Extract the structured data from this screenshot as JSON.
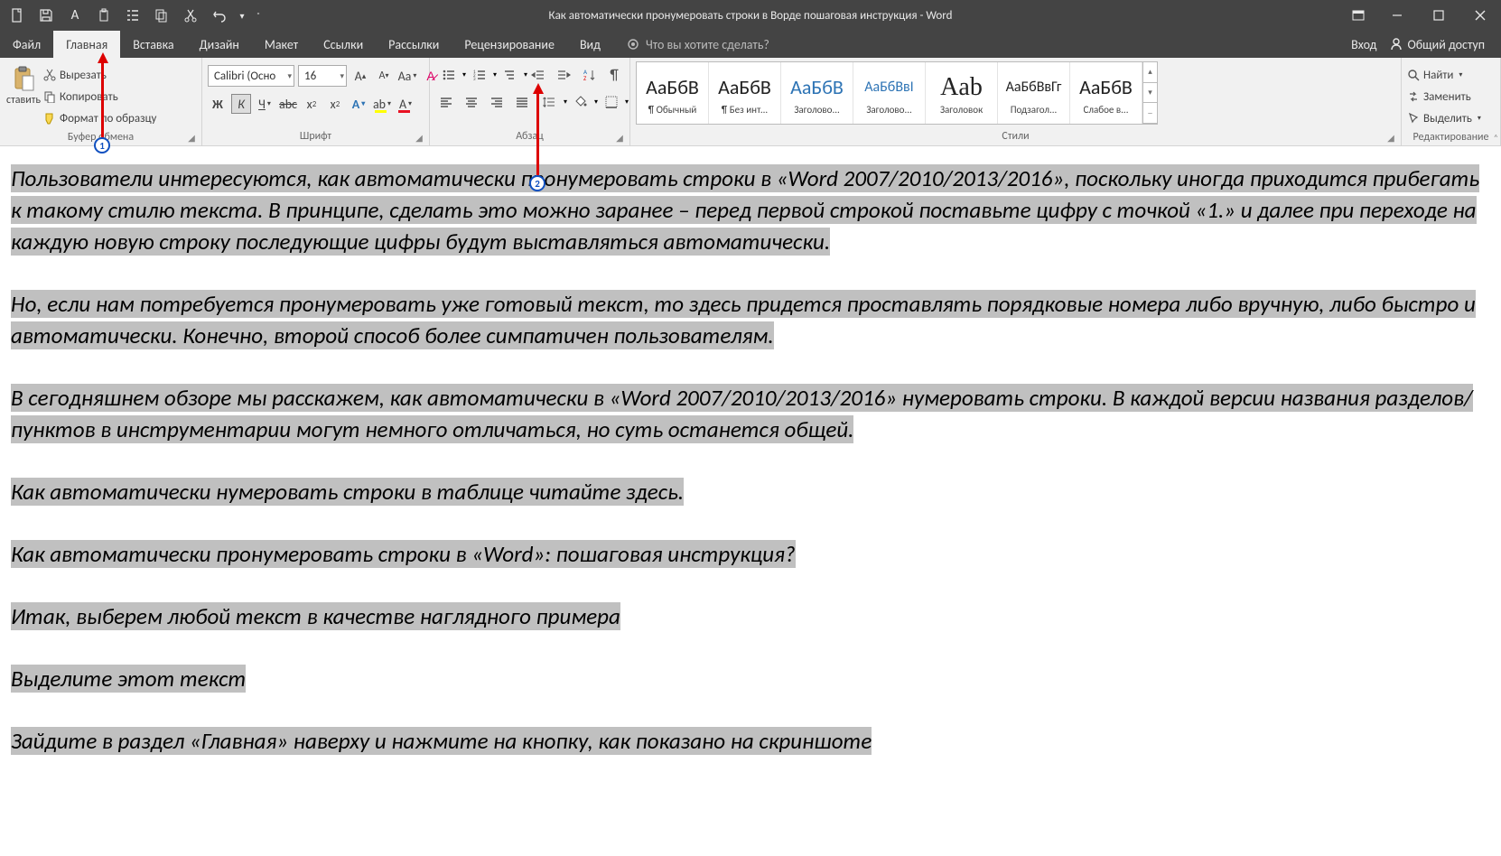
{
  "title": "Как автоматически пронумеровать строки в Ворде пошаговая инструкция - Word",
  "tabs": {
    "file": "Файл",
    "home": "Главная",
    "insert": "Вставка",
    "design": "Дизайн",
    "layout": "Макет",
    "references": "Ссылки",
    "mailings": "Рассылки",
    "review": "Рецензирование",
    "view": "Вид",
    "tellme": "Что вы хотите сделать?",
    "signin": "Вход",
    "share": "Общий доступ"
  },
  "clipboard": {
    "paste": "ставить",
    "cut": "Вырезать",
    "copy": "Копировать",
    "formatpainter": "Формат по образцу",
    "group": "Буфер обмена"
  },
  "font": {
    "name": "Calibri (Осно",
    "size": "16",
    "bold": "Ж",
    "italic": "К",
    "underline": "Ч",
    "strike": "abc",
    "sub": "x",
    "sup": "x",
    "casebtn": "Aa",
    "group": "Шрифт"
  },
  "para": {
    "group": "Абзац"
  },
  "styles": {
    "items": [
      {
        "preview": "АаБбВ",
        "name": "¶ Обычный",
        "cls": ""
      },
      {
        "preview": "АаБбВ",
        "name": "¶ Без инт...",
        "cls": ""
      },
      {
        "preview": "АаБбВ",
        "name": "Заголово...",
        "cls": "blue"
      },
      {
        "preview": "АаБбВвІ",
        "name": "Заголово...",
        "cls": "blue small"
      },
      {
        "preview": "Aab",
        "name": "Заголовок",
        "cls": "big"
      },
      {
        "preview": "АаБбВвГг",
        "name": "Подзагол...",
        "cls": "small"
      },
      {
        "preview": "АаБбВ",
        "name": "Слабое в...",
        "cls": ""
      }
    ],
    "group": "Стили"
  },
  "editing": {
    "find": "Найти",
    "replace": "Заменить",
    "select": "Выделить",
    "group": "Редактирование"
  },
  "doc": {
    "p1": "Пользователи интересуются, как автоматически пронумеровать строки в «Word 2007/2010/2013/2016», поскольку иногда приходится прибегать к такому стилю текста. В принципе, сделать это можно заранее – перед первой строкой поставьте цифру с точкой «1.» и далее при переходе на каждую новую строку последующие цифры будут выставляться автоматически.",
    "p2": "Но, если нам потребуется пронумеровать уже готовый текст, то здесь придется проставлять порядковые номера либо вручную, либо быстро и автоматически. Конечно, второй способ более симпатичен пользователям.",
    "p3": "В сегодняшнем обзоре мы расскажем, как автоматически в «Word 2007/2010/2013/2016» нумеровать строки. В каждой версии названия разделов/пунктов в инструментарии могут немного отличаться, но суть останется общей.",
    "p4": "Как автоматически нумеровать строки в таблице читайте здесь.",
    "p5": "Как автоматически пронумеровать строки в «Word»: пошаговая инструкция?",
    "p6": "Итак, выберем любой текст в качестве наглядного примера",
    "p7": "Выделите этот текст",
    "p8": "Зайдите в раздел «Главная» наверху и нажмите на кнопку, как показано на скриншоте"
  },
  "annotations": {
    "b1": "1",
    "b2": "2"
  }
}
